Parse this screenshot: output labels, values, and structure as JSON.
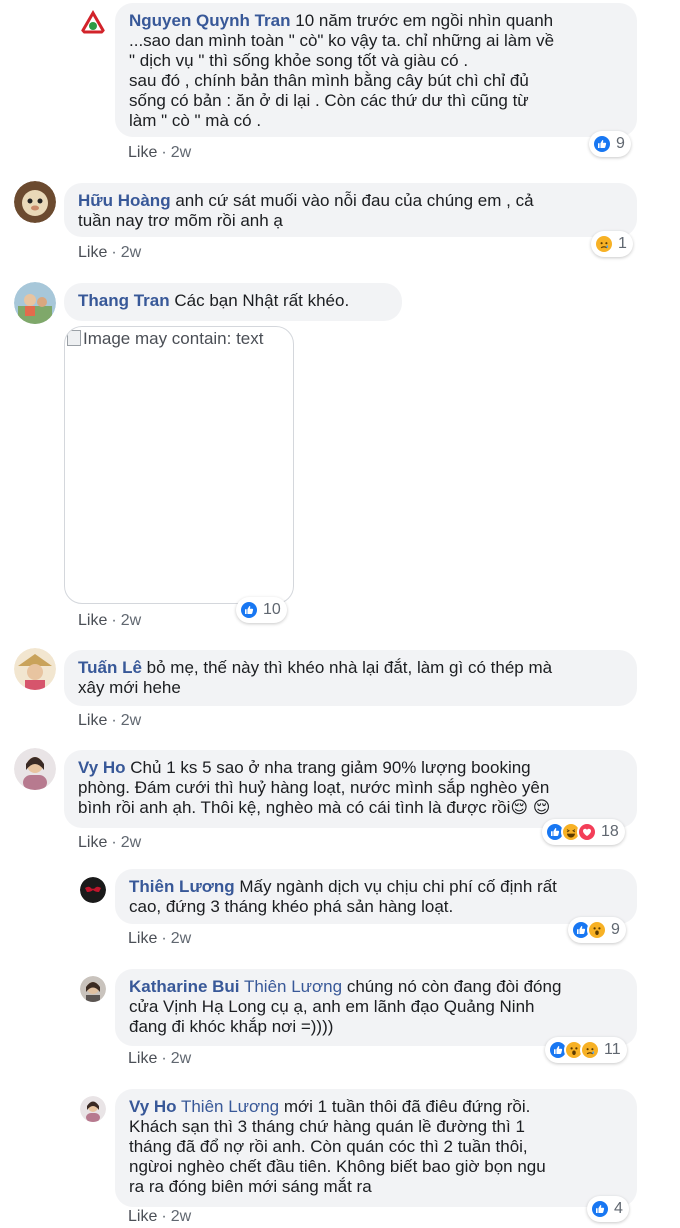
{
  "comments": [
    {
      "author": "Nguyen Quynh Tran",
      "mention": "",
      "lines": [
        "10 năm trước em ngồi nhìn quanh",
        "...sao dan mình toàn \" cò\" ko vậy ta. chỉ những ai làm về",
        "\" dịch vụ \" thì sống khỏe song tốt và giàu có .",
        "sau đó , chính bản thân mình bằng cây bút chì chỉ đủ",
        "sống có bản : ăn ở di lại . Còn các thứ dư thì cũng từ",
        "làm \" cò \" mà có ."
      ],
      "like": "Like",
      "time": "2w",
      "reactions": [
        "like"
      ],
      "reaction_count": "9"
    },
    {
      "author": "Hữu Hoàng",
      "mention": "",
      "lines": [
        "anh cứ sát muối vào nỗi đau của chúng em , cả",
        "tuần nay trơ mõm rồi anh ạ"
      ],
      "like": "Like",
      "time": "2w",
      "reactions": [
        "sad"
      ],
      "reaction_count": "1"
    },
    {
      "author": "Thang Tran",
      "mention": "",
      "lines": [
        "Các bạn Nhật rất khéo."
      ],
      "image_alt": "Image may contain: text",
      "like": "Like",
      "time": "2w",
      "reactions": [
        "like"
      ],
      "reaction_count": "10"
    },
    {
      "author": "Tuấn Lê",
      "mention": "",
      "lines": [
        "bỏ mẹ, thế này thì khéo nhà lại đắt, làm gì có thép mà",
        "xây mới hehe"
      ],
      "like": "Like",
      "time": "2w",
      "reactions": [],
      "reaction_count": ""
    },
    {
      "author": "Vy Ho",
      "mention": "",
      "lines": [
        "Chủ 1 ks 5 sao ở nha trang giảm 90% lượng booking",
        "phòng. Đám cưới thì huỷ hàng loạt, nước mình sắp nghèo yên",
        "bình rồi anh ạh. Thôi kệ, nghèo mà có cái tình là được rồi😌 😌"
      ],
      "like": "Like",
      "time": "2w",
      "reactions": [
        "like",
        "haha",
        "love"
      ],
      "reaction_count": "18"
    },
    {
      "author": "Thiên Lương",
      "mention": "",
      "lines": [
        "Mấy ngành dịch vụ chịu chi phí cố định rất",
        "cao, đứng 3 tháng khéo phá sản hàng loạt."
      ],
      "like": "Like",
      "time": "2w",
      "reactions": [
        "like",
        "wow"
      ],
      "reaction_count": "9"
    },
    {
      "author": "Katharine Bui",
      "mention": "Thiên Lương",
      "lines": [
        "chúng nó còn đang đòi đóng",
        "cửa Vịnh Hạ Long cụ ạ, anh em lãnh đạo Quảng Ninh",
        "đang đi khóc khắp nơi =))))"
      ],
      "like": "Like",
      "time": "2w",
      "reactions": [
        "like",
        "wow",
        "sad"
      ],
      "reaction_count": "11"
    },
    {
      "author": "Vy Ho",
      "mention": "Thiên Lương",
      "lines": [
        "mới 1 tuần thôi đã điêu đứng rồi.",
        "Khách sạn thì 3 tháng chứ hàng quán lề đường thì 1",
        "tháng đã đổ nợ rồi anh. Còn quán cóc thì 2 tuần thôi,",
        "ngừoi nghèo chết đầu tiên. Không biết bao giờ bọn ngu",
        "ra ra đóng biên mới sáng mắt ra"
      ],
      "like": "Like",
      "time": "2w",
      "reactions": [
        "like"
      ],
      "reaction_count": "4"
    }
  ],
  "colors": {
    "author": "#385898",
    "bubble": "#f2f3f5",
    "meta": "#606770",
    "like_reaction": "#1877f2",
    "love_reaction": "#f33e58",
    "emoji_yellow": "#f7b125"
  },
  "icons": {
    "like": "thumbs-up-icon",
    "love": "heart-icon",
    "haha": "laughing-face-icon",
    "wow": "surprised-face-icon",
    "sad": "sad-face-icon"
  }
}
